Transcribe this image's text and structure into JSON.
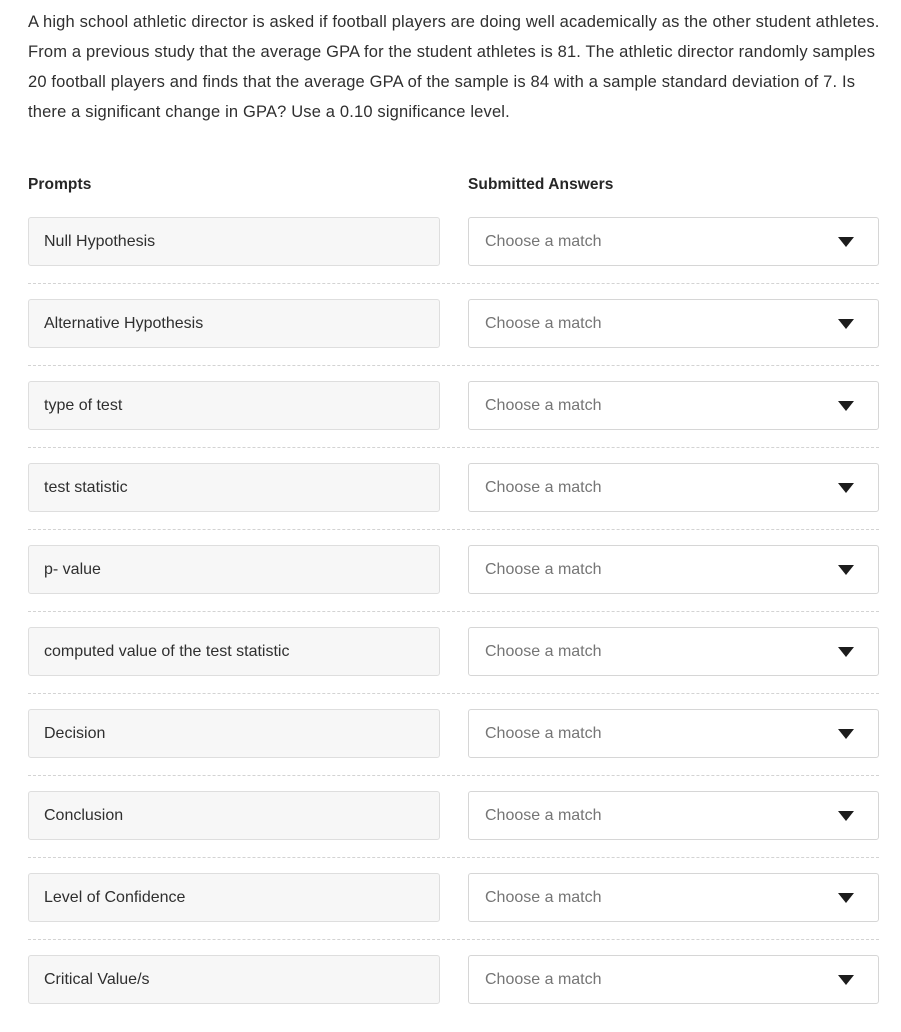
{
  "question": {
    "stem": "A high school athletic director is asked if football players are doing well academically as the other student athletes. From a previous study that the average GPA for the student athletes is 81. The athletic director randomly samples 20 football players and finds that the average GPA of the sample is 84 with a sample standard deviation of 7. Is there a significant change in GPA? Use a 0.10 significance level."
  },
  "headers": {
    "prompts": "Prompts",
    "submitted_answers": "Submitted Answers"
  },
  "placeholder": "Choose a match",
  "dropdown_icon": "chevron-down-icon",
  "colors": {
    "page_background": "#ffffff",
    "prompt_background": "#f7f7f7",
    "prompt_border": "#dedede",
    "select_background": "#ffffff",
    "select_border": "#d6d6d6",
    "divider": "#d3d3d3",
    "body_text": "#2f2f2f",
    "placeholder_text": "#757575",
    "header_text": "#262626",
    "chevron": "#1c1c1c"
  },
  "rows": [
    {
      "prompt": "Null Hypothesis",
      "answer": "Choose a match"
    },
    {
      "prompt": "Alternative Hypothesis",
      "answer": "Choose a match"
    },
    {
      "prompt": "type of test",
      "answer": "Choose a match"
    },
    {
      "prompt": "test statistic",
      "answer": "Choose a match"
    },
    {
      "prompt": "p- value",
      "answer": "Choose a match"
    },
    {
      "prompt": "computed value of the test statistic",
      "answer": "Choose a match"
    },
    {
      "prompt": "Decision",
      "answer": "Choose a match"
    },
    {
      "prompt": "Conclusion",
      "answer": "Choose a match"
    },
    {
      "prompt": "Level of Confidence",
      "answer": "Choose a match"
    },
    {
      "prompt": "Critical Value/s",
      "answer": "Choose a match"
    }
  ]
}
